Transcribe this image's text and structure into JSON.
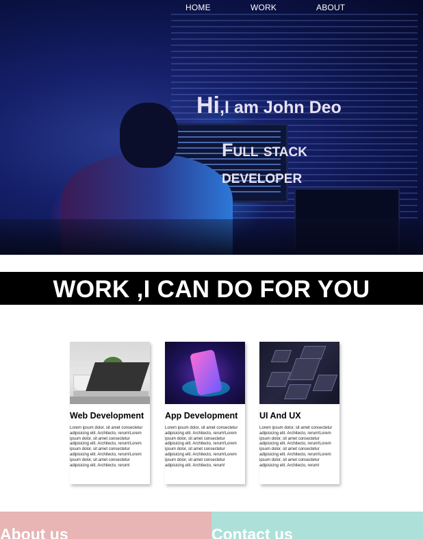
{
  "nav": {
    "home": "HOME",
    "work": "WORK",
    "about": "ABOUT"
  },
  "hero": {
    "greeting_big": "Hi",
    "greeting_rest": ",I am John Deo",
    "subtitle_line1": "Full stack",
    "subtitle_line2": "developer"
  },
  "work_section": {
    "title": "WORK ,I CAN DO FOR YOU"
  },
  "cards": [
    {
      "title": "Web Development",
      "text": "Lorem ipsum dolor, sit amet consectetur adipisicing elit. Architecto, rerum!Lorem ipsum dolor, sit amet consectetur adipisicing elit. Architecto, rerum!Lorem ipsum dolor, sit amet consectetur adipisicing elit. Architecto, rerum!Lorem ipsum dolor, sit amet consectetur adipisicing elit. Architecto, rerum!"
    },
    {
      "title": "App Development",
      "text": "Lorem ipsum dolor, sit amet consectetur adipisicing elit. Architecto, rerum!Lorem ipsum dolor, sit amet consectetur adipisicing elit. Architecto, rerum!Lorem ipsum dolor, sit amet consectetur adipisicing elit. Architecto, rerum!Lorem ipsum dolor, sit amet consectetur adipisicing elit. Architecto, rerum!"
    },
    {
      "title": "UI And UX",
      "text": "Lorem ipsum dolor, sit amet consectetur adipisicing elit. Architecto, rerum!Lorem ipsum dolor, sit amet consectetur adipisicing elit. Architecto, rerum!Lorem ipsum dolor, sit amet consectetur adipisicing elit. Architecto, rerum!Lorem ipsum dolor, sit amet consectetur adipisicing elit. Architecto, rerum!"
    }
  ],
  "bottom": {
    "about_title": "About us",
    "contact_title": "Contact us"
  },
  "colors": {
    "work_banner_bg": "#000000",
    "about_bg": "#e8b4b4",
    "contact_bg": "#ace0d8",
    "hero_text": "#e6e2f2"
  }
}
